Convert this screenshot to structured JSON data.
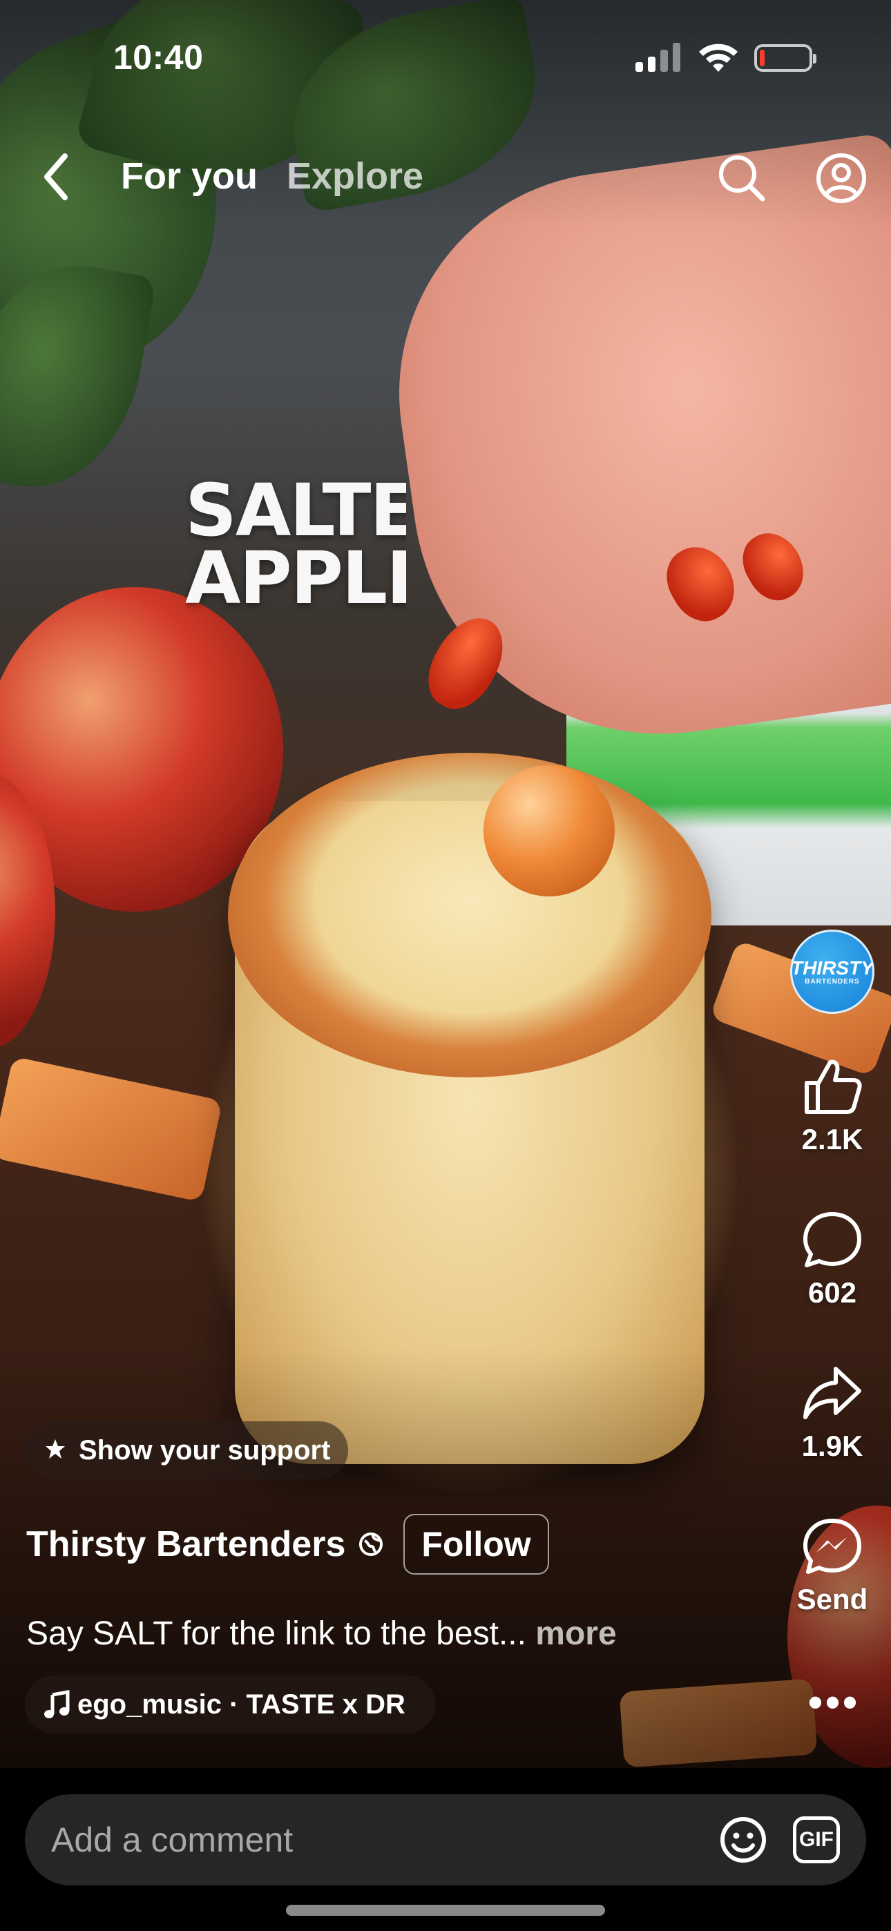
{
  "status_bar": {
    "time": "10:40"
  },
  "header": {
    "tabs": [
      {
        "label": "For you",
        "active": true
      },
      {
        "label": "Explore",
        "active": false
      }
    ]
  },
  "video": {
    "overlay_text": "SALTED\nAPPLE M"
  },
  "actions": {
    "avatar_text": "THIRSTY",
    "avatar_subtext": "BARTENDERS",
    "likes": "2.1K",
    "comments": "602",
    "shares": "1.9K",
    "send_label": "Send",
    "more_label": "•••"
  },
  "post": {
    "support_label": "Show your support",
    "author": "Thirsty Bartenders",
    "follow_label": "Follow",
    "caption": "Say SALT for the link to the best...",
    "caption_more": "more",
    "music": "ego_music · TASTE x DR"
  },
  "comment_bar": {
    "placeholder": "Add a comment",
    "gif_label": "GIF"
  },
  "colors": {
    "accent_blue": "#1E88E5",
    "comment_bg": "#262626",
    "battery_low": "#FF3B30"
  }
}
